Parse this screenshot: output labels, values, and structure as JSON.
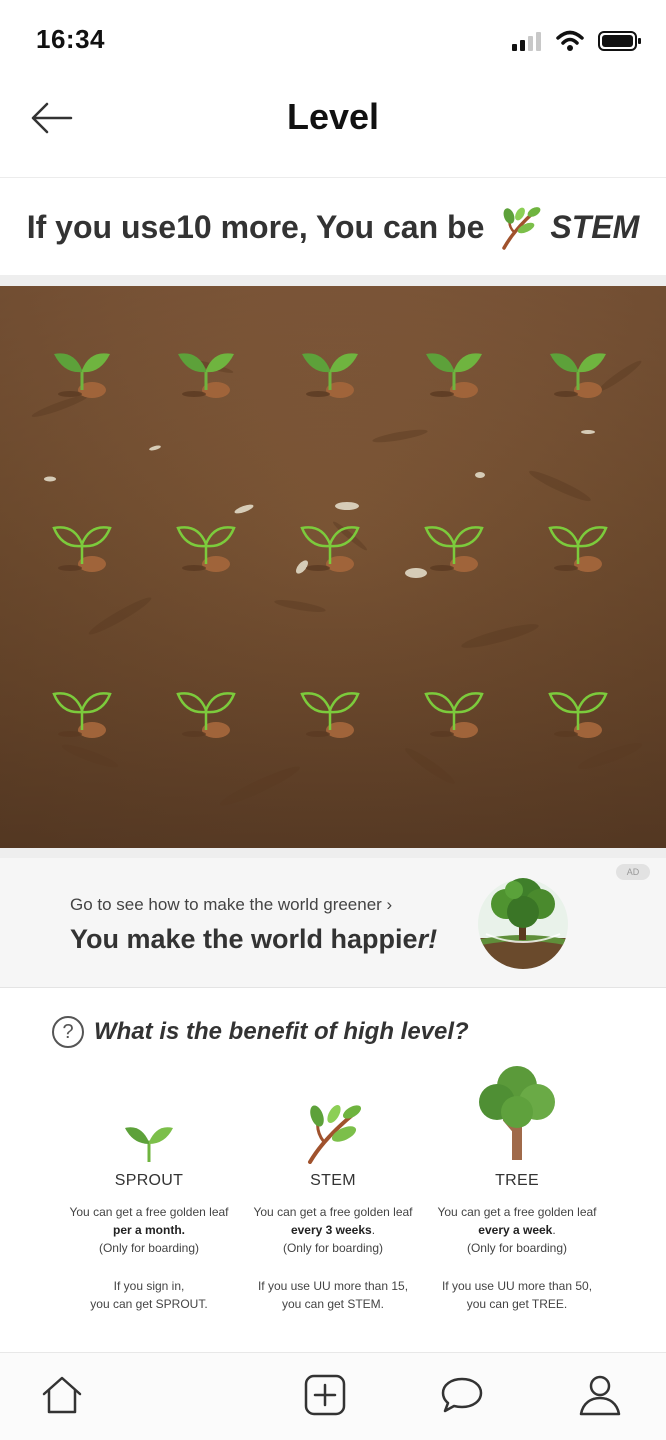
{
  "status_bar": {
    "time": "16:34"
  },
  "nav": {
    "title": "Level"
  },
  "level_hint": {
    "prefix": "If you use10 more, You can be",
    "next_level": "STEM"
  },
  "ad": {
    "badge": "AD",
    "link": "Go to see how to make the world greener ›",
    "headline_main": "You make the world happie",
    "headline_end": "r!"
  },
  "benefits": {
    "title": "What is the benefit of high level?",
    "help_glyph": "?",
    "levels": [
      {
        "name": "SPROUT",
        "desc_line1": "You can get a free golden leaf",
        "desc_bold": "per a month.",
        "desc_note": "(Only for boarding)",
        "cond_line1": "If you sign in,",
        "cond_line2": "you can get SPROUT."
      },
      {
        "name": "STEM",
        "desc_line1": "You can get a free golden leaf",
        "desc_bold": "every 3 weeks",
        "desc_bold_suffix": ".",
        "desc_note": "(Only for boarding)",
        "cond_line1": "If you use UU more than 15,",
        "cond_line2": "you can get STEM."
      },
      {
        "name": "TREE",
        "desc_line1": "You can get a free golden leaf",
        "desc_bold": "every a week",
        "desc_bold_suffix": ".",
        "desc_note": "(Only for boarding)",
        "cond_line1": "If you use UU more than 50,",
        "cond_line2": "you can get TREE."
      }
    ]
  },
  "field": {
    "filled_sprouts": 5,
    "empty_outlines": 10,
    "total_slots": 15
  },
  "colors": {
    "leaf_green": "#6fb43f",
    "outline_green": "#7ccb3c",
    "soil": "#7b5535",
    "dirt_mound": "#a0643a"
  },
  "tab_bar": {
    "icons": [
      "home-icon",
      "add-icon",
      "chat-icon",
      "profile-icon"
    ]
  }
}
